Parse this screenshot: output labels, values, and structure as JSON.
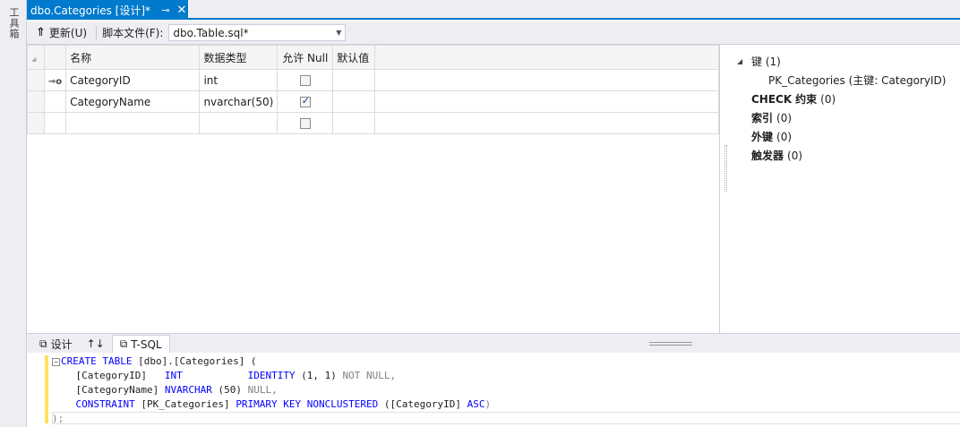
{
  "toolbox": {
    "label": "工具箱"
  },
  "document_tab": {
    "title": "dbo.Categories [设计]*",
    "pin_icon": "pin-icon",
    "close_icon": "close-icon"
  },
  "toolbar": {
    "update_label": "更新(U)",
    "script_file_label": "脚本文件(F):",
    "script_file_value": "dbo.Table.sql*"
  },
  "grid": {
    "headers": {
      "name": "名称",
      "datatype": "数据类型",
      "allow_null": "允许 Null",
      "default": "默认值"
    },
    "rows": [
      {
        "key": true,
        "name": "CategoryID",
        "datatype": "int",
        "allow_null": false,
        "default": ""
      },
      {
        "key": false,
        "name": "CategoryName",
        "datatype": "nvarchar(50)",
        "allow_null": true,
        "default": ""
      },
      {
        "key": false,
        "name": "",
        "datatype": "",
        "allow_null": false,
        "default": ""
      }
    ]
  },
  "properties": {
    "keys": {
      "label": "键",
      "count": "(1)"
    },
    "pk": {
      "name": "PK_Categories",
      "detail": "(主键: CategoryID)"
    },
    "check": {
      "label": "CHECK",
      "suffix": "约束",
      "count": "(0)"
    },
    "index": {
      "label": "索引",
      "count": "(0)"
    },
    "foreign": {
      "label": "外键",
      "count": "(0)"
    },
    "trigger": {
      "label": "触发器",
      "count": "(0)"
    }
  },
  "bottom_tabs": [
    {
      "label": "设计",
      "icon": "design-icon"
    },
    {
      "label": "↑↓",
      "icon": "swap-icon"
    },
    {
      "label": "T-SQL",
      "icon": "tsql-icon"
    }
  ],
  "code": {
    "l1_kw": "CREATE TABLE",
    "l1_tx": " [dbo].[Categories] (",
    "l2_tx": "    [CategoryID]   ",
    "l2_kw1": "INT",
    "l2_sp": "           ",
    "l2_kw2": "IDENTITY",
    "l2_num": " (1, 1) ",
    "l2_kw3": "NOT NULL",
    "l2_end": ",",
    "l3_tx": "    [CategoryName] ",
    "l3_kw": "NVARCHAR",
    "l3_num": " (50) ",
    "l3_gy": "NULL",
    "l3_end": ",",
    "l4_kw1": "    CONSTRAINT",
    "l4_tx": " [PK_Categories] ",
    "l4_kw2": "PRIMARY KEY NONCLUSTERED",
    "l4_tx2": " ([CategoryID] ",
    "l4_kw3": "ASC",
    "l4_end": ")",
    "l5": ");"
  }
}
